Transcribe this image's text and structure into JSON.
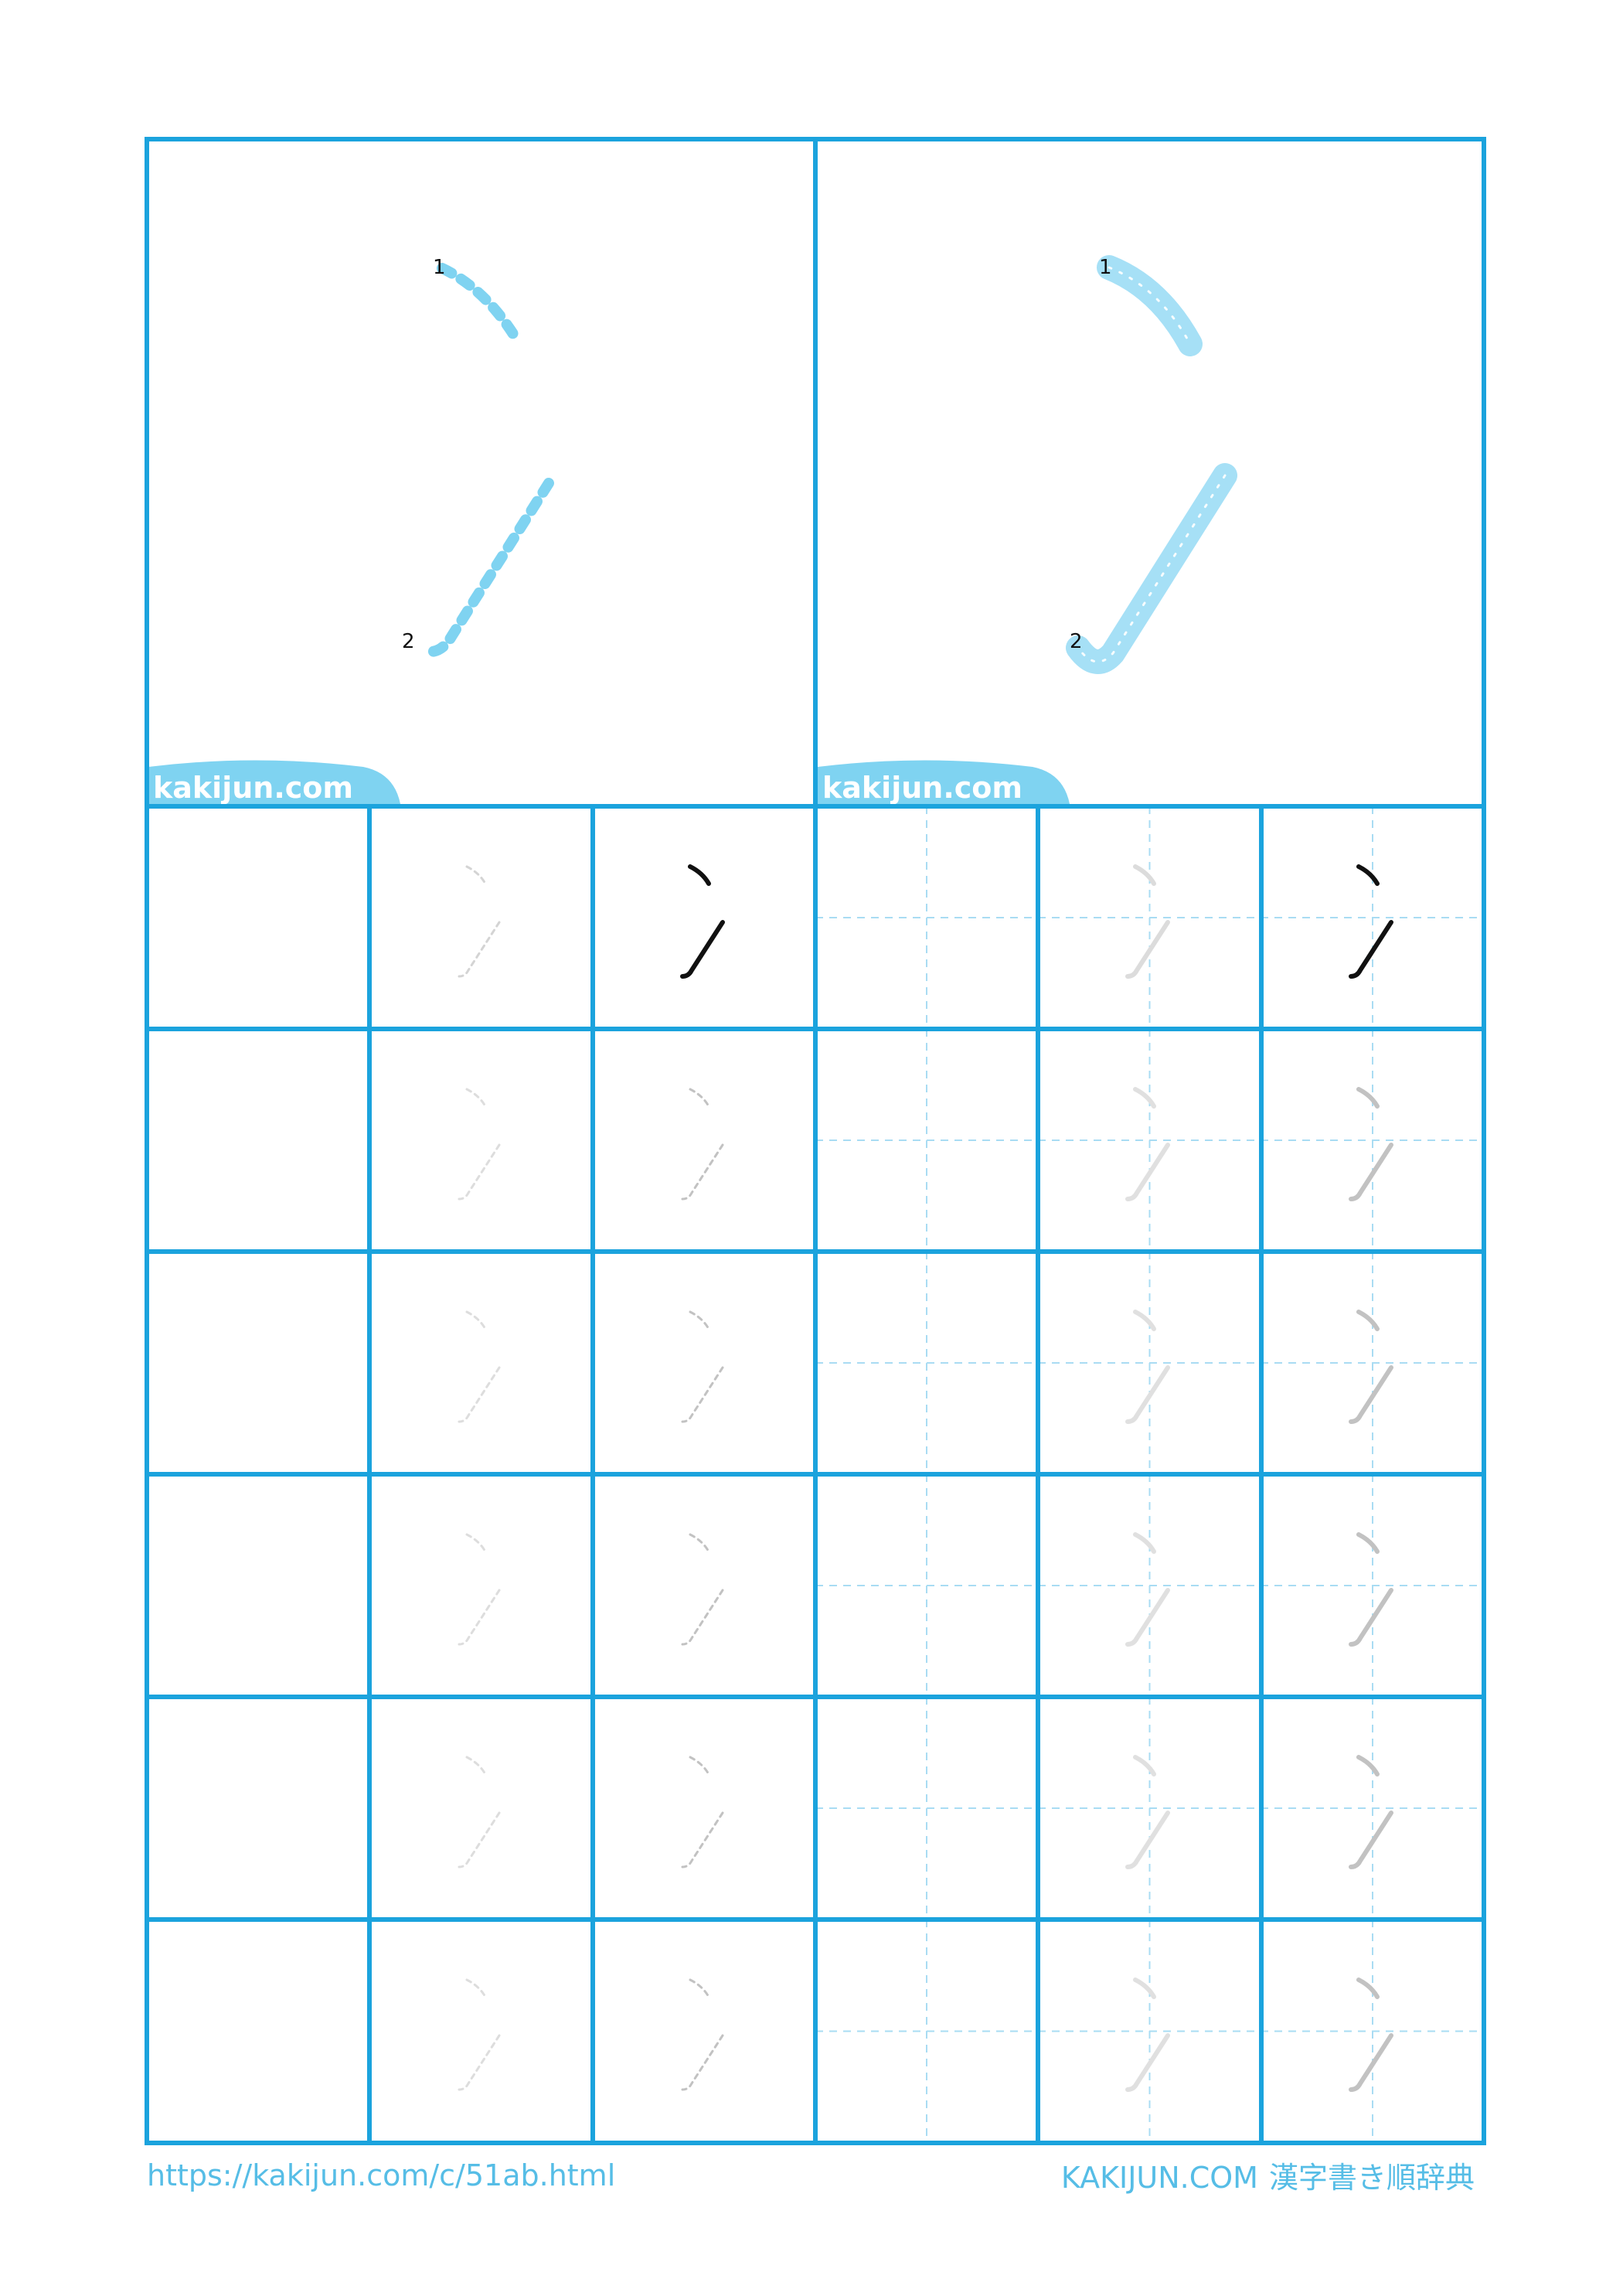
{
  "sheet": {
    "character": "冫",
    "stroke_numbers": [
      "1",
      "2"
    ],
    "tab_label": "kakijun.com",
    "colors": {
      "grid": "#1ba3dd",
      "guide": "#a9dcf3",
      "stroke_light": "#7fd3f1",
      "stroke_fill": "#a6e0f6",
      "trace_faint": "#d4d4d4",
      "trace_mid": "#c2c2c2",
      "ink": "#111111"
    }
  },
  "footer": {
    "url": "https://kakijun.com/c/51ab.html",
    "site": "KAKIJUN.COM",
    "title": "漢字書き順辞典"
  }
}
